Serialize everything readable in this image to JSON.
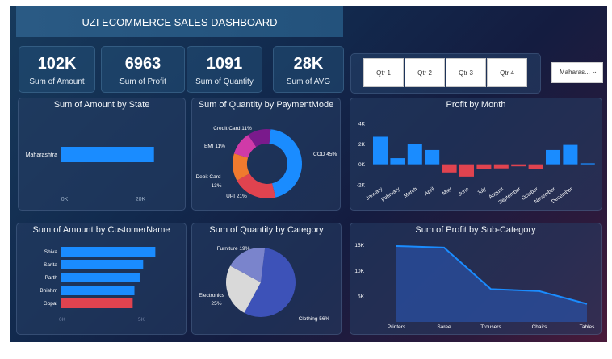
{
  "header": {
    "title": "UZI ECOMMERCE SALES DASHBOARD"
  },
  "kpis": [
    {
      "value": "102K",
      "label": "Sum of Amount"
    },
    {
      "value": "6963",
      "label": "Sum of Profit"
    },
    {
      "value": "1091",
      "label": "Sum of Quantity"
    },
    {
      "value": "28K",
      "label": "Sum of AVG"
    }
  ],
  "slicer": {
    "quarters": [
      "Qtr 1",
      "Qtr 2",
      "Qtr 3",
      "Qtr 4"
    ],
    "state_selected": "Maharas..."
  },
  "colors": {
    "blue": "#1a8cff",
    "red": "#e0434f",
    "panel": "#263e64"
  },
  "chart_data": [
    {
      "type": "bar",
      "orientation": "horizontal",
      "title": "Sum of Amount by State",
      "categories": [
        "Maharashtra"
      ],
      "values": [
        27000
      ],
      "xticks": [
        "0K",
        "20K"
      ],
      "xlim": [
        0,
        28000
      ]
    },
    {
      "type": "pie",
      "donut": true,
      "title": "Sum of Quantity by PaymentMode",
      "labels": [
        "COD",
        "UPI",
        "Debit Card",
        "EMI",
        "Credit Card"
      ],
      "values": [
        45,
        21,
        13,
        11,
        11
      ],
      "value_labels": [
        "COD 45%",
        "UPI 21%",
        "Debit Card 13%",
        "EMI 11%",
        "Credit Card 11%"
      ],
      "colors": [
        "#1a8cff",
        "#e0434f",
        "#f07a2e",
        "#d03aa8",
        "#7a1a8c"
      ]
    },
    {
      "type": "bar",
      "title": "Profit by Month",
      "categories": [
        "January",
        "February",
        "March",
        "April",
        "May",
        "June",
        "July",
        "August",
        "September",
        "October",
        "November",
        "December"
      ],
      "values": [
        2700,
        600,
        2000,
        1400,
        -800,
        -1200,
        -500,
        -400,
        -200,
        -500,
        1400,
        1900,
        100
      ],
      "yticks": [
        "4K",
        "2K",
        "0K",
        "-2K"
      ],
      "ylim": [
        -2000,
        4000
      ]
    },
    {
      "type": "bar",
      "orientation": "horizontal",
      "title": "Sum of Amount by CustomerName",
      "categories": [
        "Shiva",
        "Sarita",
        "Parth",
        "Bhishm",
        "Gopal"
      ],
      "values": [
        5400,
        4700,
        4500,
        4200,
        4100
      ],
      "xticks": [
        "0K",
        "5K"
      ],
      "xlim": [
        0,
        5800
      ]
    },
    {
      "type": "pie",
      "title": "Sum of Quantity by Category",
      "labels": [
        "Clothing",
        "Electronics",
        "Furniture"
      ],
      "values": [
        56,
        25,
        19
      ],
      "value_labels": [
        "Clothing 56%",
        "Electronics 25%",
        "Furniture 19%"
      ],
      "colors": [
        "#3d52b8",
        "#d9d9d9",
        "#7a84cc"
      ]
    },
    {
      "type": "area",
      "title": "Sum of Profit by Sub-Category",
      "categories": [
        "Printers",
        "Saree",
        "Trousers",
        "Chairs",
        "Tables"
      ],
      "values": [
        14800,
        14500,
        6400,
        6000,
        3500
      ],
      "yticks": [
        "15K",
        "10K",
        "5K"
      ],
      "ylim": [
        0,
        17000
      ]
    }
  ]
}
